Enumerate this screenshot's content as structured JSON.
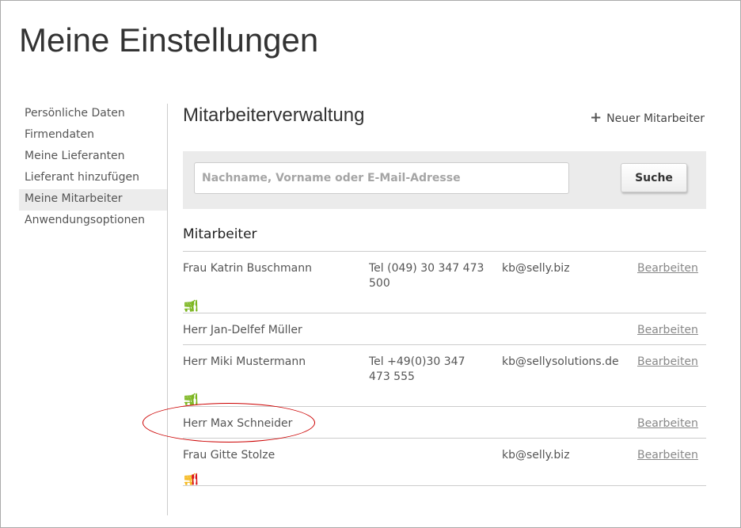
{
  "page_title": "Meine Einstellungen",
  "sidebar": {
    "items": [
      {
        "label": "Persönliche Daten"
      },
      {
        "label": "Firmendaten"
      },
      {
        "label": "Meine Lieferanten"
      },
      {
        "label": "Lieferant hinzufügen"
      },
      {
        "label": "Meine Mitarbeiter",
        "active": true
      },
      {
        "label": "Anwendungsoptionen"
      }
    ]
  },
  "main": {
    "heading": "Mitarbeiterverwaltung",
    "new_employee": "Neuer Mitarbeiter",
    "search_placeholder": "Nachname, Vorname oder E-Mail-Adresse",
    "search_button": "Suche",
    "section": "Mitarbeiter",
    "rows": [
      {
        "name": "Frau Katrin Buschmann",
        "phone": "Tel (049) 30 347 473 500",
        "email": "kb@selly.biz",
        "action": "Bearbeiten",
        "cart_color": "#7ab51d",
        "fork_color": "#7ab51d"
      },
      {
        "name": "Herr Jan-Delfef Müller",
        "phone": "",
        "email": "",
        "action": "Bearbeiten"
      },
      {
        "name": "Herr Miki Mustermann",
        "phone": "Tel +49(0)30 347 473 555",
        "email": "kb@sellysolutions.de",
        "action": "Bearbeiten",
        "cart_color": "#7ab51d",
        "fork_color": "#7ab51d"
      },
      {
        "name": "Herr Max Schneider",
        "phone": "",
        "email": "",
        "action": "Bearbeiten"
      },
      {
        "name": "Frau Gitte Stolze",
        "phone": "",
        "email": "kb@selly.biz",
        "action": "Bearbeiten",
        "cart_color": "#f5b81c",
        "fork_color": "#d9141a"
      }
    ]
  }
}
